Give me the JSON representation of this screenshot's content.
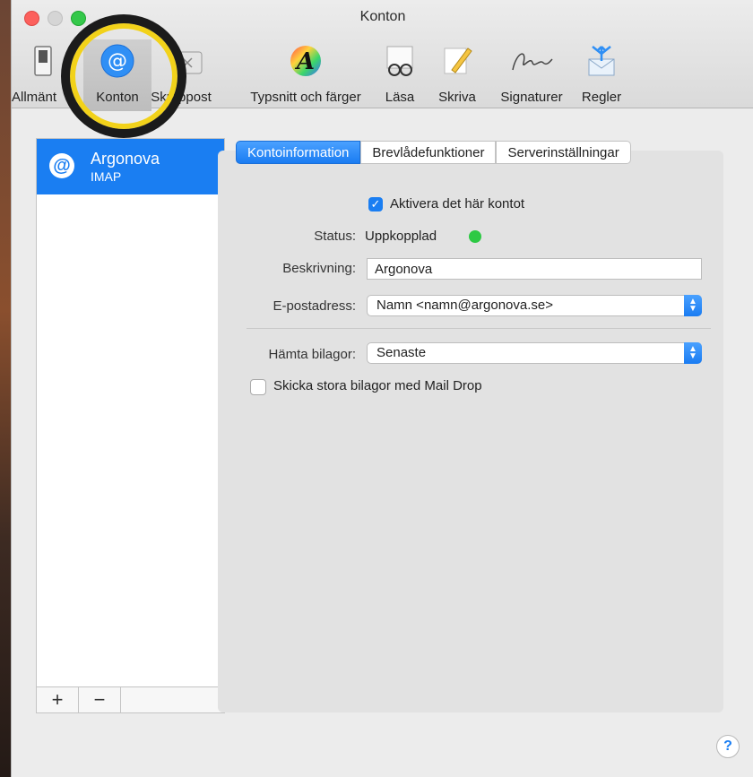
{
  "window": {
    "title": "Konton"
  },
  "toolbar": {
    "items": [
      {
        "label": "Allmänt",
        "icon": "switch-icon"
      },
      {
        "label": "Konton",
        "icon": "at-sign-icon",
        "selected": true
      },
      {
        "label": "Skräppost",
        "icon": "junk-bin-icon"
      },
      {
        "label": "Typsnitt och färger",
        "icon": "font-color-icon"
      },
      {
        "label": "Läsa",
        "icon": "reading-glasses-icon"
      },
      {
        "label": "Skriva",
        "icon": "pencil-icon"
      },
      {
        "label": "Signaturer",
        "icon": "signature-icon"
      },
      {
        "label": "Regler",
        "icon": "rules-envelope-icon"
      }
    ]
  },
  "sidebar": {
    "accounts": [
      {
        "name": "Argonova",
        "type": "IMAP",
        "selected": true
      }
    ],
    "add_label": "+",
    "remove_label": "−"
  },
  "tabs": [
    {
      "label": "Kontoinformation",
      "active": true
    },
    {
      "label": "Brevlådefunktioner",
      "active": false
    },
    {
      "label": "Serverinställningar",
      "active": false
    }
  ],
  "form": {
    "enable_account": {
      "label": "Aktivera det här kontot",
      "checked": true
    },
    "status": {
      "label": "Status:",
      "value": "Uppkopplad",
      "color": "#2dc944"
    },
    "description": {
      "label": "Beskrivning:",
      "value": "Argonova"
    },
    "email": {
      "label": "E-postadress:",
      "value": "Namn <namn@argonova.se>"
    },
    "attachments": {
      "label": "Hämta bilagor:",
      "value": "Senaste"
    },
    "mail_drop": {
      "label": "Skicka stora bilagor med Mail Drop",
      "checked": false
    }
  },
  "help": {
    "label": "?"
  },
  "colors": {
    "accent": "#1a7ef2",
    "highlight_ring": "#f2d21a"
  }
}
